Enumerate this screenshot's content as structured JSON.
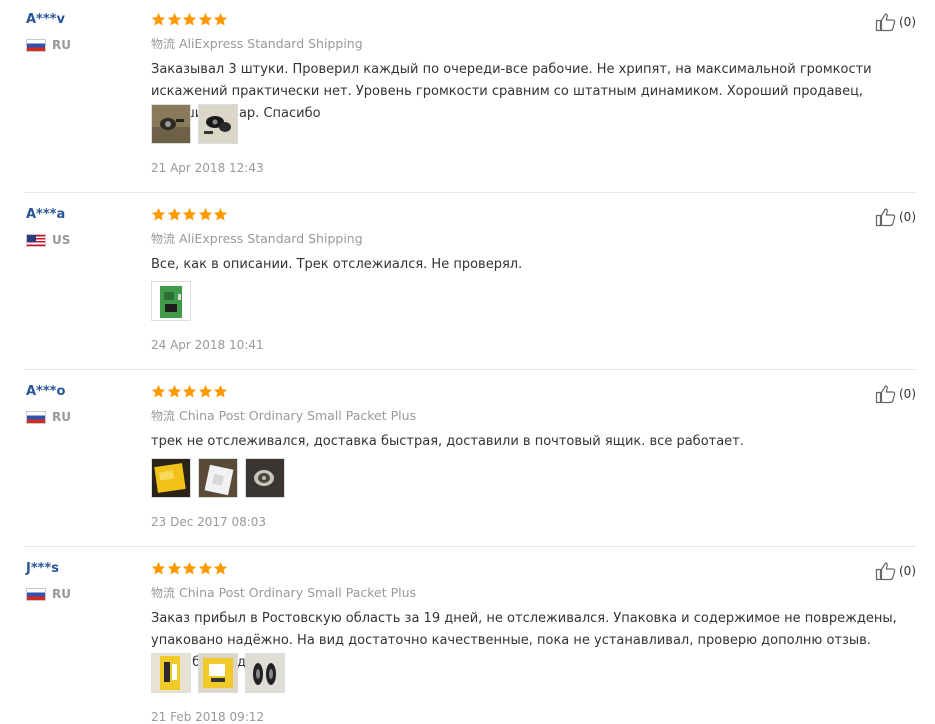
{
  "colors": {
    "star": "#ff9900",
    "buyer_name": "#2a5599",
    "muted": "#999999",
    "text": "#333333"
  },
  "reviews": [
    {
      "buyer": "A***v",
      "country": "RU",
      "flag": "ru-flag-icon",
      "stars": 5,
      "shipping_cn": "物流",
      "shipping": "AliExpress Standard Shipping",
      "text": "Заказывал 3 штуки. Проверил каждый по очереди-все рабочие. Не хрипят, на максимальной громкости искажений практически нет. Уровень громкости сравним со штатным динамиком. Хороший продавец, хороший товар. Спасибо",
      "photos": [
        "photo-speaker-brown",
        "photo-speaker-black-white"
      ],
      "date": "21 Apr 2018 12:43",
      "helpful": "(0)"
    },
    {
      "buyer": "A***a",
      "country": "US",
      "flag": "us-flag-icon",
      "stars": 5,
      "shipping_cn": "物流",
      "shipping": "AliExpress Standard Shipping",
      "text": "Все, как в описании. Трек отслежиался. Не проверял.",
      "photos": [
        "photo-green-board"
      ],
      "date": "24 Apr 2018 10:41",
      "helpful": "(0)"
    },
    {
      "buyer": "A***o",
      "country": "RU",
      "flag": "ru-flag-icon",
      "stars": 5,
      "shipping_cn": "物流",
      "shipping": "China Post Ordinary Small Packet Plus",
      "text": "трек не отслеживался, доставка быстрая, доставили в почтовый ящик. все работает.",
      "photos": [
        "photo-yellow-package",
        "photo-white-bag",
        "photo-speaker-dark"
      ],
      "date": "23 Dec 2017 08:03",
      "helpful": "(0)"
    },
    {
      "buyer": "J***s",
      "country": "RU",
      "flag": "ru-flag-icon",
      "stars": 5,
      "shipping_cn": "物流",
      "shipping": "China Post Ordinary Small Packet Plus",
      "text": "Заказ прибыл в Ростовскую область за 19 дней, не отслеживался. Упаковка и содержимое не повреждены, упаковано надёжно. На вид достаточно качественные, пока не устанавливал, проверю дополню отзыв. Спасибо продавцу.",
      "photos": [
        "photo-yellow-envelope",
        "photo-yellow-parcel",
        "photo-speakers-pair"
      ],
      "date": "21 Feb 2018 09:12",
      "helpful": "(0)"
    }
  ]
}
